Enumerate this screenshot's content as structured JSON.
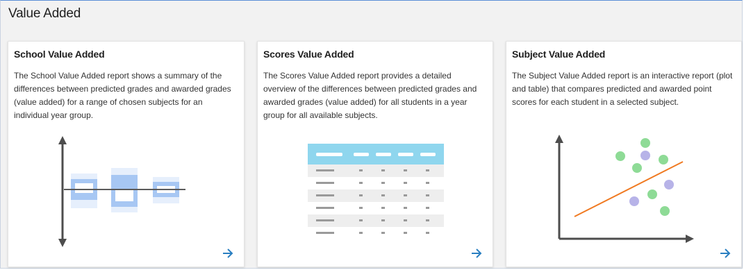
{
  "page": {
    "title": "Value Added"
  },
  "cards": [
    {
      "title": "School Value Added",
      "description": "The School Value Added report shows a summary of the differences between predicted grades and awarded grades (value added) for a range of chosen subjects for an individual year group.",
      "illustration": "box-plot-illustration",
      "arrow_icon": "arrow-right-icon"
    },
    {
      "title": "Scores Value Added",
      "description": "The Scores Value Added report provides a detailed overview of the differences between predicted grades and awarded grades (value added) for all students in a year group for all available subjects.",
      "illustration": "table-illustration",
      "arrow_icon": "arrow-right-icon"
    },
    {
      "title": "Subject Value Added",
      "description": "The Subject Value Added report is an interactive report (plot and table) that compares predicted and awarded point scores for each student in a selected subject.",
      "illustration": "scatter-plot-illustration",
      "arrow_icon": "arrow-right-icon"
    }
  ],
  "colors": {
    "accent_blue": "#2a7fc1",
    "axis_gray": "#4d4d4d",
    "light_blue": "#9cc3f2",
    "pale_blue": "#e3eefc",
    "table_header": "#8fd6ee",
    "dot_green": "#8edb96",
    "dot_purple": "#b7b3e8",
    "trend_orange": "#f07a22"
  }
}
